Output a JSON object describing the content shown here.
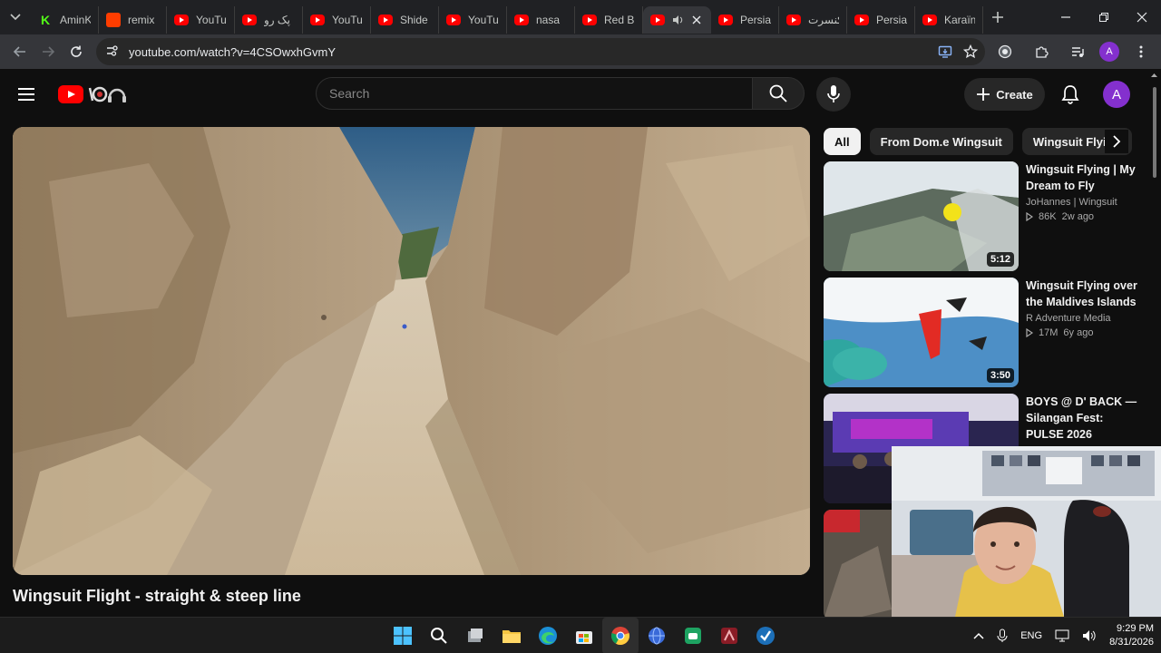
{
  "browser": {
    "tabs": [
      {
        "title": "AminK",
        "icon": "kick-icon"
      },
      {
        "title": "remix",
        "icon": "remix-icon"
      },
      {
        "title": "YouTu",
        "icon": "youtube-icon"
      },
      {
        "title": "پک رو",
        "icon": "youtube-icon"
      },
      {
        "title": "YouTu",
        "icon": "youtube-icon"
      },
      {
        "title": "Shide",
        "icon": "youtube-icon"
      },
      {
        "title": "YouTu",
        "icon": "youtube-icon"
      },
      {
        "title": "nasa",
        "icon": "youtube-icon"
      },
      {
        "title": "Red Bu",
        "icon": "youtube-icon"
      },
      {
        "title": "",
        "icon": "youtube-icon",
        "active": true
      },
      {
        "title": "Persia",
        "icon": "youtube-icon"
      },
      {
        "title": "کنسرت",
        "icon": "youtube-icon"
      },
      {
        "title": "Persia",
        "icon": "youtube-icon"
      },
      {
        "title": "Karaïn",
        "icon": "youtube-icon"
      }
    ],
    "url": "youtube.com/watch?v=4CSOwxhGvmY",
    "profile_initial": "A"
  },
  "youtube": {
    "search_placeholder": "Search",
    "create_label": "Create",
    "avatar_initial": "A",
    "video_title": "Wingsuit Flight - straight & steep line",
    "chips": [
      "All",
      "From Dom.e Wingsuit",
      "Wingsuit Flying"
    ],
    "recommendations": [
      {
        "title": "Wingsuit Flying | My Dream to Fly",
        "channel": "JoHannes | Wingsuit",
        "views": "86K",
        "age": "2w ago",
        "duration": "5:12"
      },
      {
        "title": "Wingsuit Flying over the Maldives Islands",
        "channel": "R Adventure Media",
        "views": "17M",
        "age": "6y ago",
        "duration": "3:50"
      },
      {
        "title": "BOYS @ D' BACK — Silangan Fest: PULSE 2026",
        "channel": "",
        "views": "",
        "age": "",
        "duration": ""
      }
    ]
  },
  "taskbar": {
    "language": "ENG",
    "time": "9:29 PM",
    "date": "8/31/2026"
  },
  "colors": {
    "yt_bg": "#0f0f0f",
    "yt_red": "#ff0000",
    "chrome_tabstrip": "#202124",
    "chrome_toolbar": "#35363a",
    "avatar": "#8430ce"
  }
}
